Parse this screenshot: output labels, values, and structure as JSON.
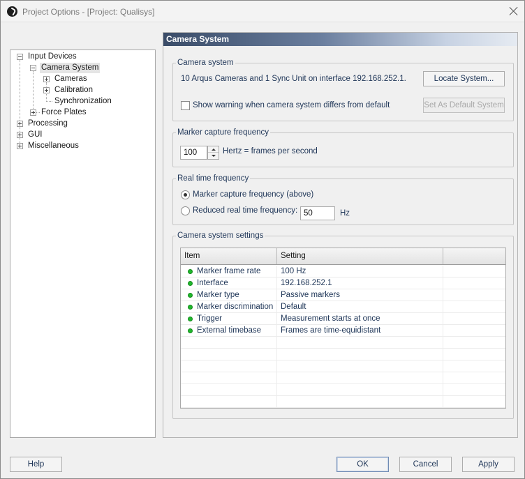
{
  "window": {
    "title": "Project Options - [Project: Qualisys]"
  },
  "tree": {
    "items": [
      {
        "label": "Input Devices",
        "expander": "minus"
      },
      {
        "label": "Camera System",
        "expander": "minus",
        "selected": true
      },
      {
        "label": "Cameras",
        "expander": "plus"
      },
      {
        "label": "Calibration",
        "expander": "plus"
      },
      {
        "label": "Synchronization",
        "expander": "none"
      },
      {
        "label": "Force Plates",
        "expander": "plus"
      },
      {
        "label": "Processing",
        "expander": "plus"
      },
      {
        "label": "GUI",
        "expander": "plus"
      },
      {
        "label": "Miscellaneous",
        "expander": "plus"
      }
    ]
  },
  "panel": {
    "header": "Camera System",
    "camera_system": {
      "title": "Camera system",
      "info": "10 Arqus Cameras and 1 Sync Unit on interface 192.168.252.1.",
      "locate_button": "Locate System...",
      "warning_checkbox": "Show warning when camera system differs from default",
      "warning_checked": false,
      "default_button": "Set As Default System"
    },
    "marker_capture": {
      "title": "Marker capture frequency",
      "value": "100",
      "unit": "Hertz = frames per second"
    },
    "realtime": {
      "title": "Real time frequency",
      "option1": "Marker capture frequency (above)",
      "option2": "Reduced real time frequency:",
      "selected": "option1",
      "reduced_value": "50",
      "reduced_unit": "Hz"
    },
    "settings": {
      "title": "Camera system settings",
      "columns": [
        "Item",
        "Setting",
        ""
      ],
      "rows": [
        {
          "item": "Marker frame rate",
          "setting": "100 Hz",
          "status_color": "#1fb82c"
        },
        {
          "item": "Interface",
          "setting": "192.168.252.1",
          "status_color": "#1fb82c"
        },
        {
          "item": "Marker type",
          "setting": "Passive markers",
          "status_color": "#1fb82c"
        },
        {
          "item": "Marker discrimination",
          "setting": "Default",
          "status_color": "#1fb82c"
        },
        {
          "item": "Trigger",
          "setting": "Measurement starts at once",
          "status_color": "#1fb82c"
        },
        {
          "item": "External timebase",
          "setting": "Frames are time-equidistant",
          "status_color": "#1fb82c"
        }
      ]
    }
  },
  "footer": {
    "help": "Help",
    "ok": "OK",
    "cancel": "Cancel",
    "apply": "Apply"
  }
}
